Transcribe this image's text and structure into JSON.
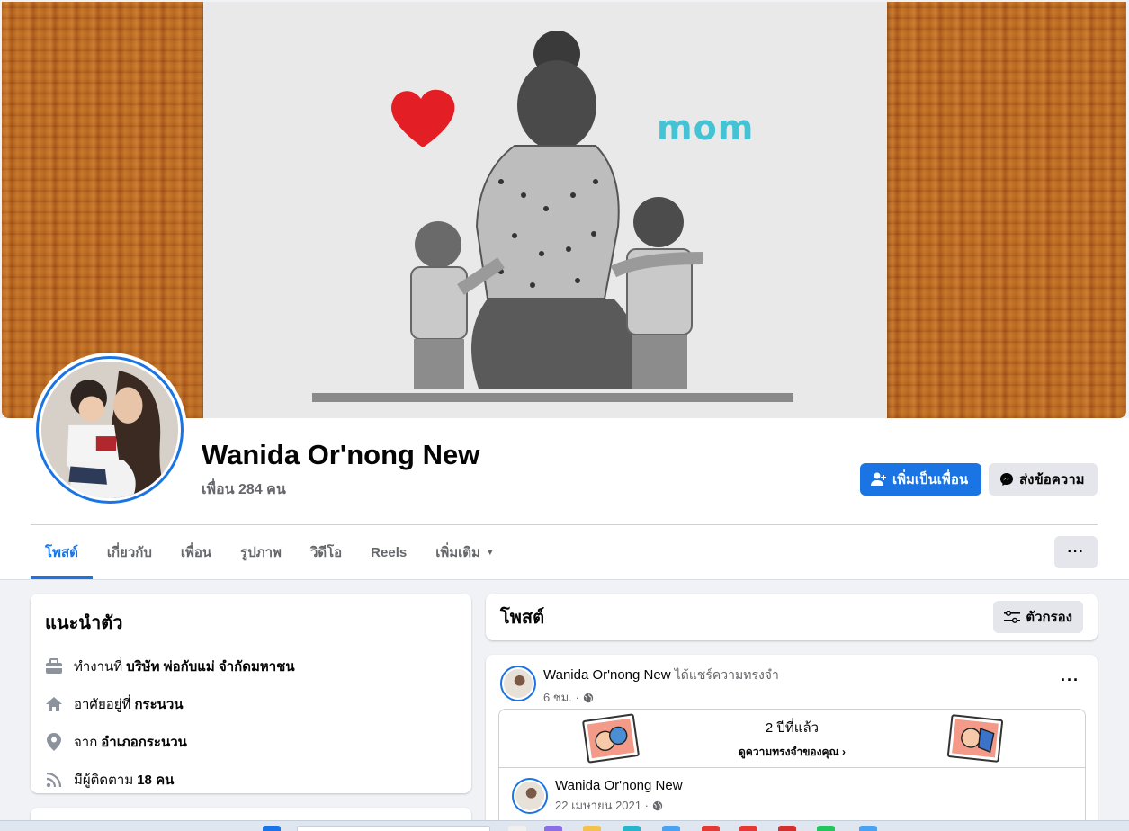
{
  "profile": {
    "name": "Wanida Or'nong New",
    "friends": "เพื่อน 284 คน",
    "cover_text": "mom"
  },
  "actions": {
    "add_friend": "เพิ่มเป็นเพื่อน",
    "message": "ส่งข้อความ"
  },
  "tabs": [
    {
      "label": "โพสต์",
      "active": true
    },
    {
      "label": "เกี่ยวกับ",
      "active": false
    },
    {
      "label": "เพื่อน",
      "active": false
    },
    {
      "label": "รูปภาพ",
      "active": false
    },
    {
      "label": "วิดีโอ",
      "active": false
    },
    {
      "label": "Reels",
      "active": false
    },
    {
      "label": "เพิ่มเติม",
      "active": false
    }
  ],
  "more_menu": "···",
  "intro": {
    "title": "แนะนำตัว",
    "work_prefix": "ทำงานที่",
    "work_value": "บริษัท พ่อกับแม่ จำกัดมหาชน",
    "lives_prefix": "อาศัยอยู่ที่",
    "lives_value": "กระนวน",
    "from_prefix": "จาก",
    "from_value": "อำเภอกระนวน",
    "followers_prefix": "มีผู้ติดตาม",
    "followers_value": "18 คน"
  },
  "posts_section": {
    "title": "โพสต์",
    "filter": "ตัวกรอง"
  },
  "post": {
    "author": "Wanida Or'nong New",
    "action": "ได้แชร์ความทรงจำ",
    "time": "6 ชม. ·",
    "menu": "···",
    "memory_title": "2 ปีที่แล้ว",
    "memory_link": "ดูความทรงจำของคุณ",
    "inner_author": "Wanida Or'nong New",
    "inner_date": "22 เมษายน 2021 ·"
  },
  "colors": {
    "accent": "#1b74e4",
    "background": "#f0f2f5",
    "secondary_text": "#65676b"
  },
  "icons": {
    "add_friend": "person-plus-icon",
    "message": "messenger-icon",
    "work": "briefcase-icon",
    "home": "home-icon",
    "location": "map-pin-icon",
    "followers": "rss-icon",
    "filter": "sliders-icon",
    "privacy": "globe-icon"
  }
}
